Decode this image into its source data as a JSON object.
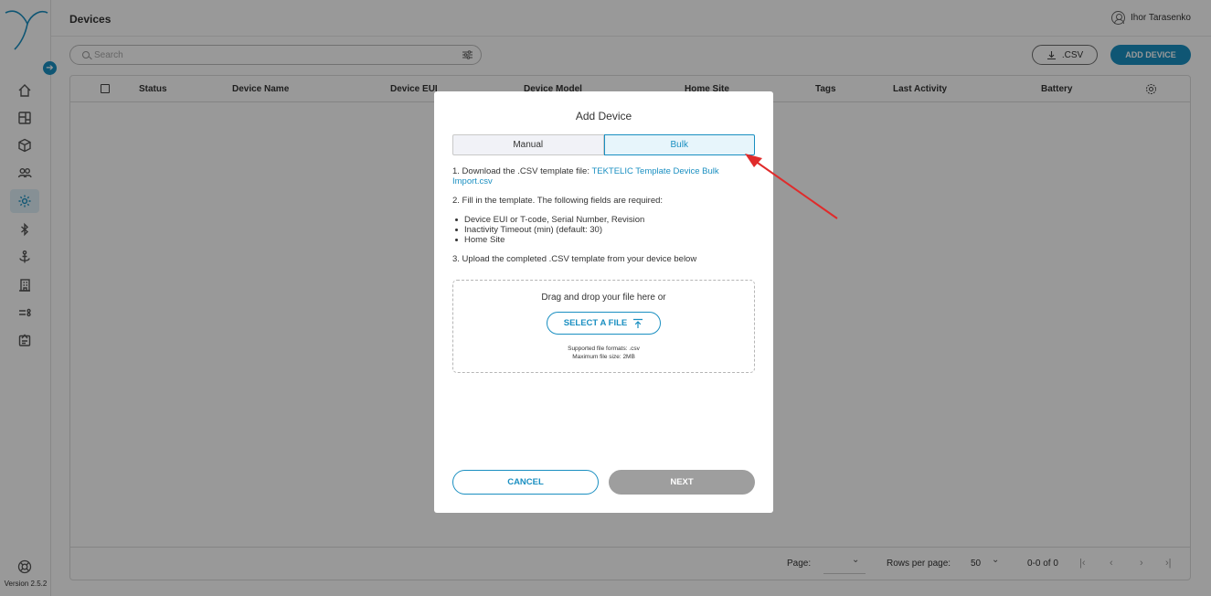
{
  "sidebar": {
    "version": "Version 2.5.2",
    "items": [
      {
        "icon": "home-icon"
      },
      {
        "icon": "dashboard-icon"
      },
      {
        "icon": "cube-icon"
      },
      {
        "icon": "users-icon"
      },
      {
        "icon": "device-gear-icon",
        "active": true
      },
      {
        "icon": "bluetooth-icon"
      },
      {
        "icon": "anchor-icon"
      },
      {
        "icon": "building-icon"
      },
      {
        "icon": "list-settings-icon"
      },
      {
        "icon": "report-icon"
      }
    ]
  },
  "header": {
    "title": "Devices",
    "user_name": "Ihor Tarasenko"
  },
  "toolbar": {
    "search_placeholder": "Search",
    "csv_label": ".CSV",
    "add_device_label": "ADD DEVICE"
  },
  "table": {
    "columns": [
      "Status",
      "Device Name",
      "Device EUI",
      "Device Model",
      "Home Site",
      "Tags",
      "Last Activity",
      "Battery"
    ],
    "footer": {
      "page_label": "Page:",
      "rows_per_page_label": "Rows per page:",
      "rows_per_page_value": "50",
      "range": "0-0 of 0"
    }
  },
  "modal": {
    "title": "Add Device",
    "tabs": [
      {
        "label": "Manual",
        "active": false
      },
      {
        "label": "Bulk",
        "active": true
      }
    ],
    "step1_text": "1. Download the .CSV template file: ",
    "step1_link": "TEKTELIC Template Device Bulk Import.csv",
    "step2_text": "2. Fill in the template. The following fields are required:",
    "required_fields": [
      "Device EUI or T-code, Serial Number, Revision",
      "Inactivity Timeout (min) (default: 30)",
      "Home Site"
    ],
    "step3_text": "3. Upload the completed .CSV template from your device below",
    "dropzone": {
      "text": "Drag and drop your file here or",
      "select_label": "SELECT A FILE",
      "formats": "Supported file formats: .csv",
      "max_size": "Maximum file size: 2MB"
    },
    "cancel_label": "CANCEL",
    "next_label": "NEXT"
  },
  "colors": {
    "accent": "#1a8fc1",
    "annotation_arrow": "#e02b2b",
    "disabled_button": "#9e9e9e"
  }
}
